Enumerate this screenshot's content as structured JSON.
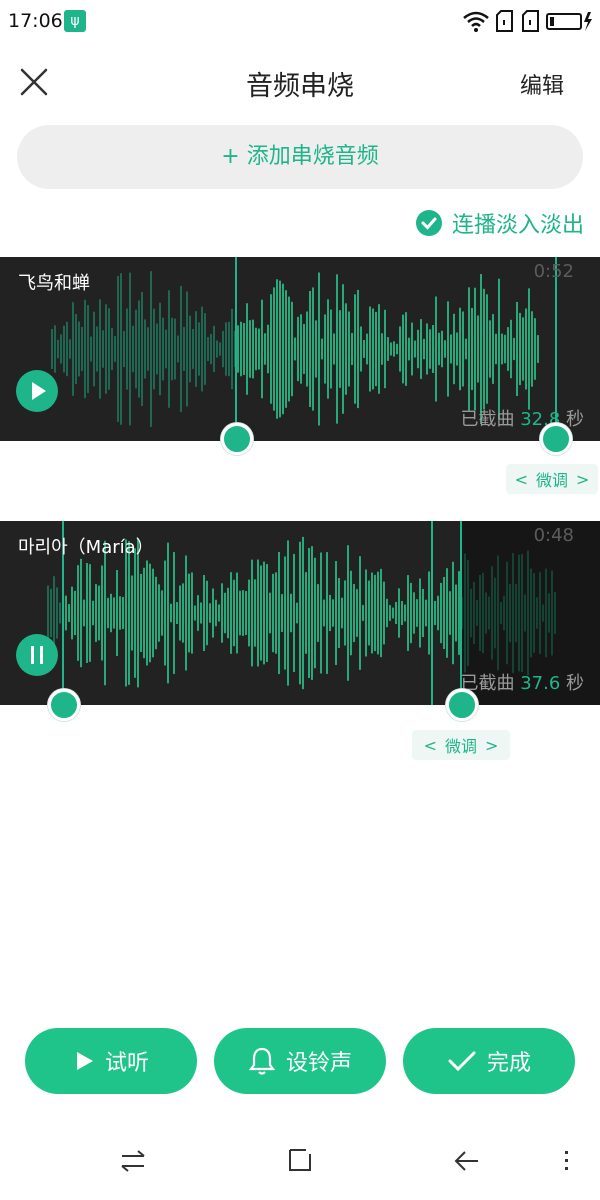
{
  "status": {
    "time": "17:06",
    "usb_icon": "usb-icon"
  },
  "header": {
    "title": "音频串烧",
    "edit": "编辑"
  },
  "add_button": {
    "label": "+ 添加串烧音频"
  },
  "fade_option": {
    "label": "连播淡入淡出",
    "checked": true
  },
  "tracks": [
    {
      "title": "飞鸟和蝉",
      "duration": "0:52",
      "cut_prefix": "已截曲",
      "cut_value": "32.8",
      "cut_unit": "秒",
      "state": "paused",
      "fine_label": "微调"
    },
    {
      "title": "마리아（María）",
      "duration": "0:48",
      "cut_prefix": "已截曲",
      "cut_value": "37.6",
      "cut_unit": "秒",
      "state": "playing",
      "fine_label": "微调"
    }
  ],
  "buttons": {
    "preview": "试听",
    "ringtone": "设铃声",
    "done": "完成"
  },
  "colors": {
    "accent": "#1fb58a",
    "track_bg": "#222222"
  }
}
